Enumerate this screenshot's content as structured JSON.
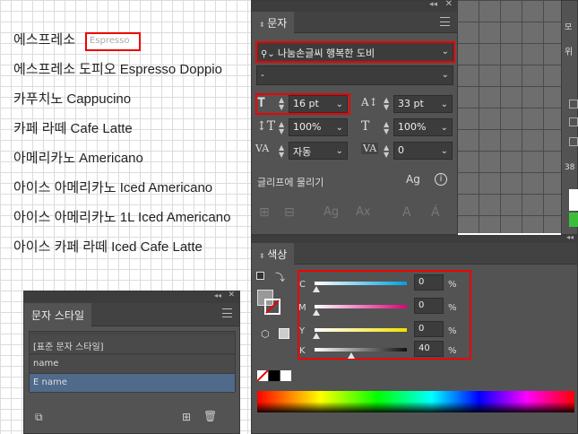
{
  "document": {
    "lines": [
      "에스프레소",
      "에스프레소 도피오 Espresso Doppio",
      "카푸치노 Cappucino",
      "카페 라떼 Cafe Latte",
      "아메리카노 Americano",
      "아이스 아메리카노 Iced Americano",
      "아이스 아메리카노 1L Iced Americano",
      "아이스 카페 라떼 Iced Cafe Latte"
    ],
    "selected_tag": "Espresso"
  },
  "character_panel": {
    "title": "문자",
    "font_family": "나눔손글씨 행복한 도비",
    "font_style": "-",
    "font_size": "16 pt",
    "leading": "33 pt",
    "vertical_scale": "100%",
    "horizontal_scale": "100%",
    "kerning": "자동",
    "tracking": "0",
    "glyph_snap_label": "글리프에 물리기"
  },
  "color_panel": {
    "title": "색상",
    "channels": [
      {
        "label": "C",
        "value": "0",
        "unit": "%"
      },
      {
        "label": "M",
        "value": "0",
        "unit": "%"
      },
      {
        "label": "Y",
        "value": "0",
        "unit": "%"
      },
      {
        "label": "K",
        "value": "40",
        "unit": "%"
      }
    ],
    "k_fraction": 0.4
  },
  "char_style_panel": {
    "title": "문자 스타일",
    "items": [
      "[표준 문자 스타일]",
      "name",
      "E name"
    ],
    "selected": "E name"
  },
  "right_panel": {
    "label1": "모",
    "label2": "위",
    "label3": "38"
  },
  "colors": {
    "panel_bg": "#535353",
    "highlight_red": "#e00000",
    "selected_row": "#4f6a8a"
  }
}
